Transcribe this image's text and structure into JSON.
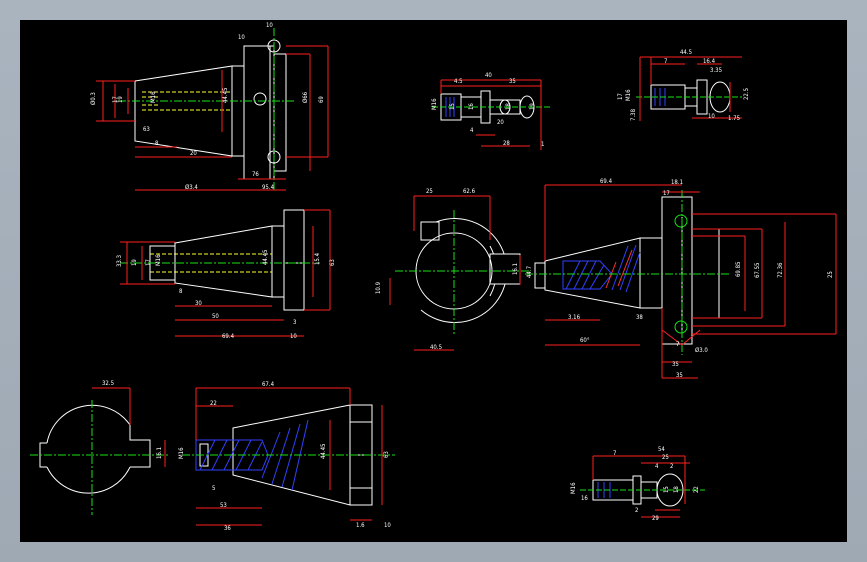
{
  "canvas": {
    "background": "#000000",
    "outer_background": "#a9b3be"
  },
  "colors": {
    "outline": "#ffffff",
    "dimension": "#ff2020",
    "centerline": "#18e018",
    "hidden": "#ffff30",
    "hatch": "#3040ff",
    "hatch_alt": "#ff3030"
  },
  "views": {
    "arbor_top": {
      "dims": [
        "10",
        "10",
        "Ø0.3",
        "19",
        "17",
        "M16",
        "44.45",
        "Ø66",
        "69",
        "63",
        "8",
        "20",
        "76",
        "Ø3.4",
        "95.4",
        "15"
      ]
    },
    "pull_stud_small": {
      "dims": [
        "40",
        "4.5",
        "35",
        "M16",
        "15",
        "16",
        "18",
        "19",
        "20",
        "4",
        "28",
        "1"
      ]
    },
    "pull_stud_top_right": {
      "dims": [
        "44.5",
        "7",
        "16.4",
        "3.35",
        "17",
        "M16",
        "22.5",
        "7.38",
        "10",
        "1.75"
      ]
    },
    "arbor_middle": {
      "dims": [
        "33.3",
        "19",
        "17",
        "M16",
        "44.45",
        "15.4",
        "63",
        "8",
        "30",
        "50",
        "69.4",
        "3",
        "10"
      ]
    },
    "flange_front": {
      "dims": [
        "25",
        "62.6",
        "16.1",
        "10.9",
        "40.5"
      ]
    },
    "arbor_section": {
      "dims": [
        "69.4",
        "18.1",
        "17",
        "44.7",
        "69.85",
        "67.55",
        "72.36",
        "25",
        "3.16",
        "38",
        "60°",
        "7",
        "Ø3.0",
        "35"
      ]
    },
    "flange_bottom_left": {
      "dims": [
        "32.5",
        "16.1"
      ]
    },
    "arbor_bottom": {
      "dims": [
        "67.4",
        "22",
        "M16",
        "44.45",
        "63",
        "5",
        "53",
        "36",
        "1.6",
        "10"
      ]
    },
    "pull_stud_bottom_right": {
      "dims": [
        "7",
        "54",
        "25",
        "4",
        "2",
        "M16",
        "15",
        "18",
        "22",
        "16",
        "2",
        "29"
      ]
    }
  }
}
